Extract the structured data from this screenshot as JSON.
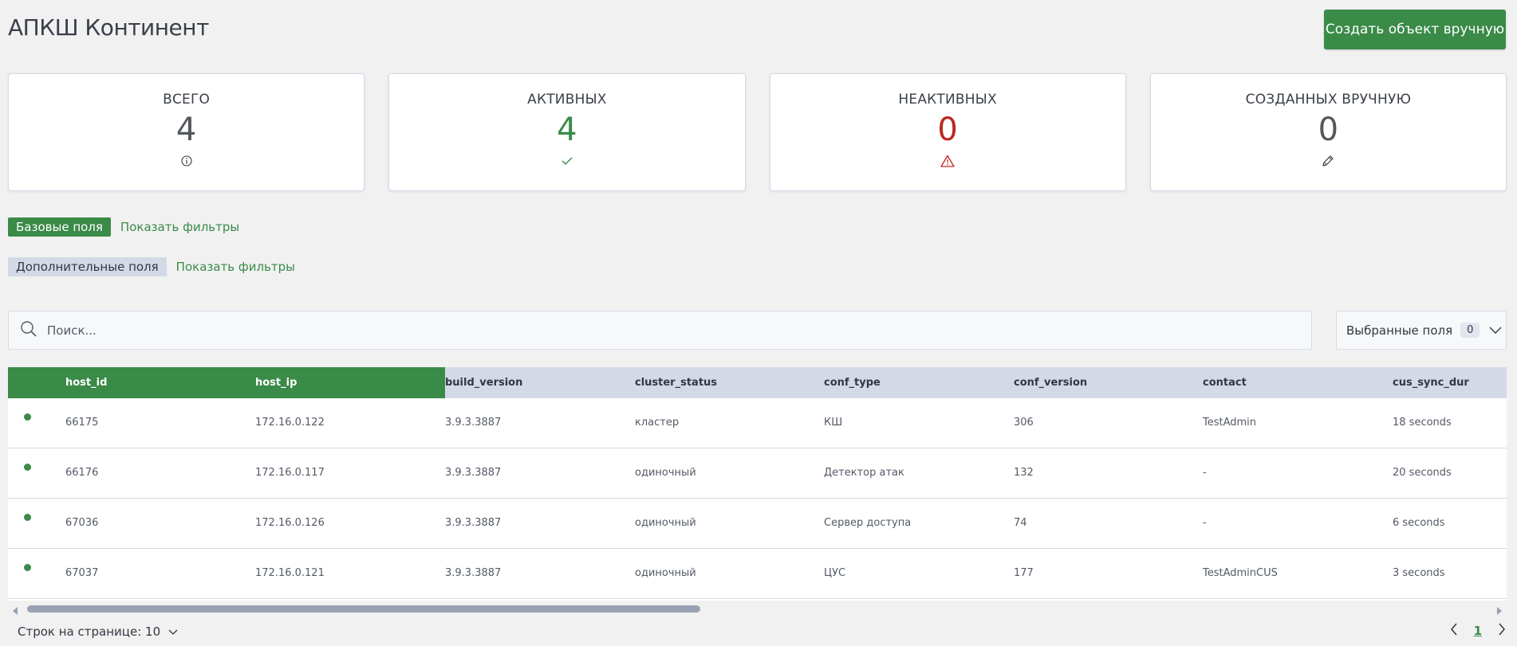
{
  "header": {
    "title": "АПКШ Континент",
    "create_button": "Создать объект вручную"
  },
  "stats": [
    {
      "title": "ВСЕГО",
      "value": "4",
      "color": "#54575c",
      "icon": "info-icon"
    },
    {
      "title": "АКТИВНЫХ",
      "value": "4",
      "color": "#3a8a48",
      "icon": "check-icon"
    },
    {
      "title": "НЕАКТИВНЫХ",
      "value": "0",
      "color": "#bd271e",
      "icon": "warning-icon"
    },
    {
      "title": "СОЗДАННЫХ ВРУЧНУЮ",
      "value": "0",
      "color": "#54575c",
      "icon": "pencil-icon"
    }
  ],
  "filters": {
    "base_label": "Базовые поля",
    "base_link": "Показать фильтры",
    "extra_label": "Дополнительные поля",
    "extra_link": "Показать фильтры"
  },
  "search": {
    "placeholder": "Поиск...",
    "fields_label": "Выбранные поля",
    "fields_count": "0"
  },
  "table": {
    "columns": [
      "host_id",
      "host_ip",
      "build_version",
      "cluster_status",
      "conf_type",
      "conf_version",
      "contact",
      "cus_sync_dur"
    ],
    "rows": [
      [
        "66175",
        "172.16.0.122",
        "3.9.3.3887",
        "кластер",
        "КШ",
        "306",
        "TestAdmin",
        "18 seconds"
      ],
      [
        "66176",
        "172.16.0.117",
        "3.9.3.3887",
        "одиночный",
        "Детектор атак",
        "132",
        "-",
        "20 seconds"
      ],
      [
        "67036",
        "172.16.0.126",
        "3.9.3.3887",
        "одиночный",
        "Сервер доступа",
        "74",
        "-",
        "6 seconds"
      ],
      [
        "67037",
        "172.16.0.121",
        "3.9.3.3887",
        "одиночный",
        "ЦУС",
        "177",
        "TestAdminCUS",
        "3 seconds"
      ]
    ]
  },
  "footer": {
    "rows_per_page": "Строк на странице: 10",
    "page": "1"
  },
  "colors": {
    "accent": "#3a8a48",
    "danger": "#bd271e",
    "header_bg": "#d3dae6"
  }
}
